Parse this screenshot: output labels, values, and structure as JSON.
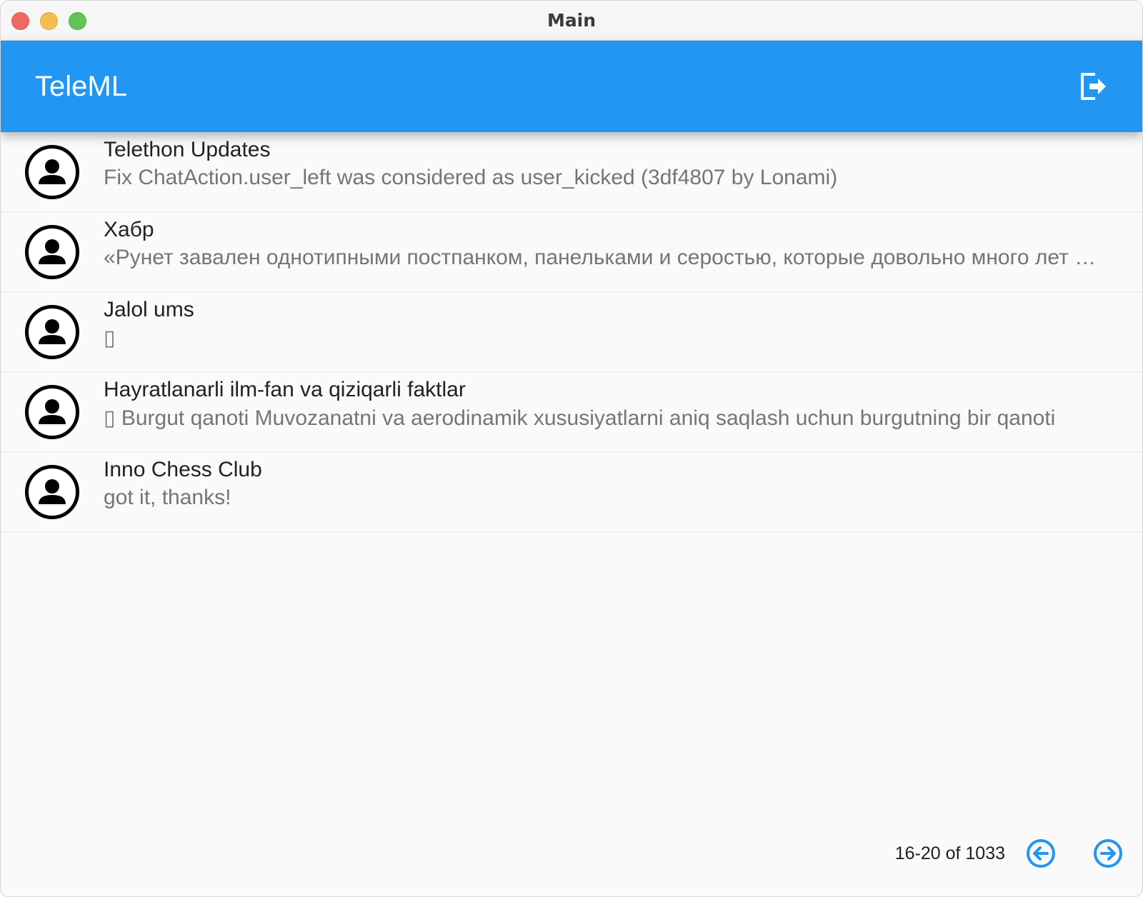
{
  "window": {
    "title": "Main"
  },
  "app_bar": {
    "title": "TeleML",
    "logout_icon": "logout-icon"
  },
  "chats": [
    {
      "title": "Telethon Updates",
      "preview": "Fix ChatAction.user_left was considered as user_kicked (3df4807 by Lonami)"
    },
    {
      "title": "Хабр",
      "preview": "«Рунет завален однотипными постпанком, панельками и серостью, которые довольно много лет назад стали трендом"
    },
    {
      "title": "Jalol ums",
      "preview": "▯"
    },
    {
      "title": "Hayratlanarli ilm-fan va qiziqarli faktlar",
      "preview": "▯ Burgut qanoti Muvozanatni va aerodinamik xususiyatlarni aniq saqlash uchun burgutning bir qanoti"
    },
    {
      "title": "Inno Chess Club",
      "preview": "got it, thanks!"
    }
  ],
  "pagination": {
    "label": "16-20 of 1033",
    "prev_icon": "arrow-left-circle-icon",
    "next_icon": "arrow-right-circle-icon"
  },
  "colors": {
    "accent": "#2196f3",
    "title_text": "#212121",
    "preview_text": "#757575"
  }
}
